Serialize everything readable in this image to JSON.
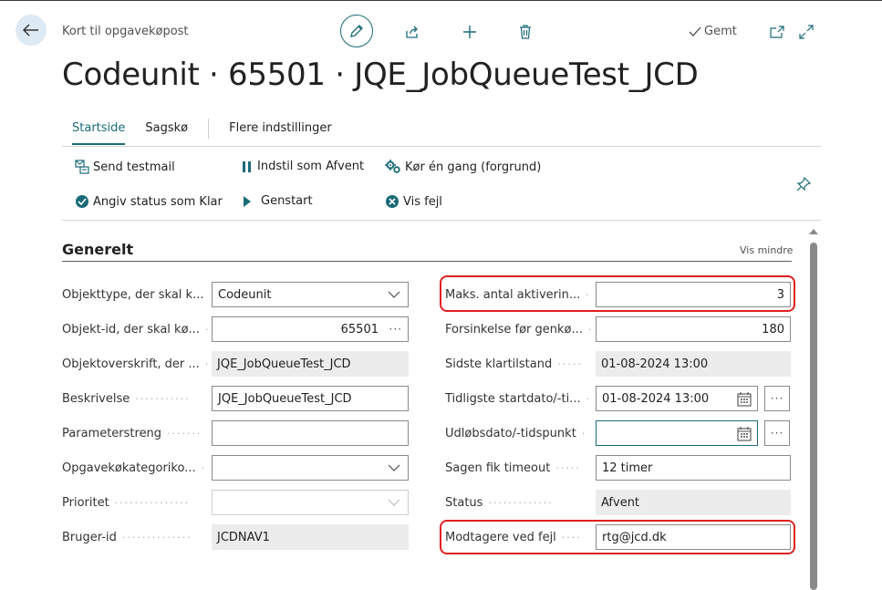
{
  "header": {
    "breadcrumb": "Kort til opgavekøpost",
    "saved_label": "Gemt",
    "title": "Codeunit · 65501 · JQE_JobQueueTest_JCD"
  },
  "tabs": [
    {
      "label": "Startside"
    },
    {
      "label": "Sagskø"
    },
    {
      "label": "Flere indstillinger"
    }
  ],
  "actions": {
    "send_testmail": "Send testmail",
    "set_on_hold": "Indstil som Afvent",
    "run_once": "Kør én gang (forgrund)",
    "set_ready": "Angiv status som Klar",
    "restart": "Genstart",
    "show_error": "Vis fejl"
  },
  "section": {
    "title": "Generelt",
    "show_less": "Vis mindre"
  },
  "left_fields": [
    {
      "label": "Objekttype, der skal k...",
      "value": "Codeunit"
    },
    {
      "label": "Objekt-id, der skal kø...",
      "value": "65501"
    },
    {
      "label": "Objektoverskrift, der ...",
      "value": "JQE_JobQueueTest_JCD"
    },
    {
      "label": "Beskrivelse",
      "value": "JQE_JobQueueTest_JCD"
    },
    {
      "label": "Parameterstreng",
      "value": ""
    },
    {
      "label": "Opgavekøkategoriko...",
      "value": ""
    },
    {
      "label": "Prioritet",
      "value": ""
    },
    {
      "label": "Bruger-id",
      "value": "JCDNAV1"
    }
  ],
  "right_fields": [
    {
      "label": "Maks. antal aktiverin...",
      "value": "3"
    },
    {
      "label": "Forsinkelse før genkø...",
      "value": "180"
    },
    {
      "label": "Sidste klartilstand",
      "value": "01-08-2024 13:00"
    },
    {
      "label": "Tidligste startdato/-ti...",
      "value": "01-08-2024 13:00"
    },
    {
      "label": "Udløbsdato/-tidspunkt",
      "value": ""
    },
    {
      "label": "Sagen fik timeout",
      "value": "12 timer"
    },
    {
      "label": "Status",
      "value": "Afvent"
    },
    {
      "label": "Modtagere ved fejl",
      "value": "rtg@jcd.dk"
    }
  ],
  "colors": {
    "accent": "#1a6b78",
    "highlight": "#e02020"
  }
}
